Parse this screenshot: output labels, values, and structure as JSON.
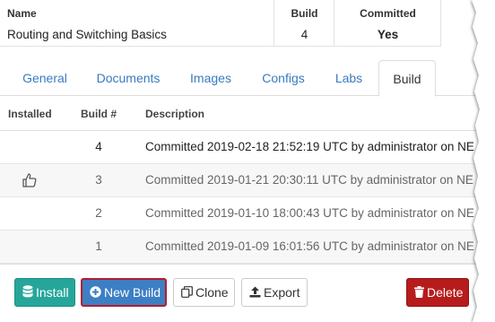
{
  "summary": {
    "name_header": "Name",
    "name_value": "Routing and Switching Basics",
    "build_header": "Build",
    "build_value": "4",
    "committed_header": "Committed",
    "committed_value": "Yes"
  },
  "tabs": [
    {
      "label": "General"
    },
    {
      "label": "Documents"
    },
    {
      "label": "Images"
    },
    {
      "label": "Configs"
    },
    {
      "label": "Labs"
    },
    {
      "label": "Build",
      "active": true
    }
  ],
  "builds": {
    "columns": {
      "installed": "Installed",
      "build": "Build #",
      "description": "Description"
    },
    "rows": [
      {
        "build": "4",
        "description": "Committed 2019-02-18 21:52:19 UTC by administrator on NE",
        "installed_icon": ""
      },
      {
        "build": "3",
        "description": "Committed 2019-01-21 20:30:11 UTC by administrator on NE",
        "installed_icon": "thumbs-up-icon"
      },
      {
        "build": "2",
        "description": "Committed 2019-01-10 18:00:43 UTC by administrator on NE",
        "installed_icon": ""
      },
      {
        "build": "1",
        "description": "Committed 2019-01-09 16:01:56 UTC by administrator on NE",
        "installed_icon": ""
      }
    ]
  },
  "buttons": {
    "install": "Install",
    "new_build": "New Build",
    "clone": "Clone",
    "export": "Export",
    "delete": "Delete"
  },
  "colors": {
    "link": "#3a7bbf",
    "install": "#26a69a",
    "new_build": "#3d7fc4",
    "new_build_highlight": "#b01e2e",
    "delete": "#b71c1c"
  }
}
